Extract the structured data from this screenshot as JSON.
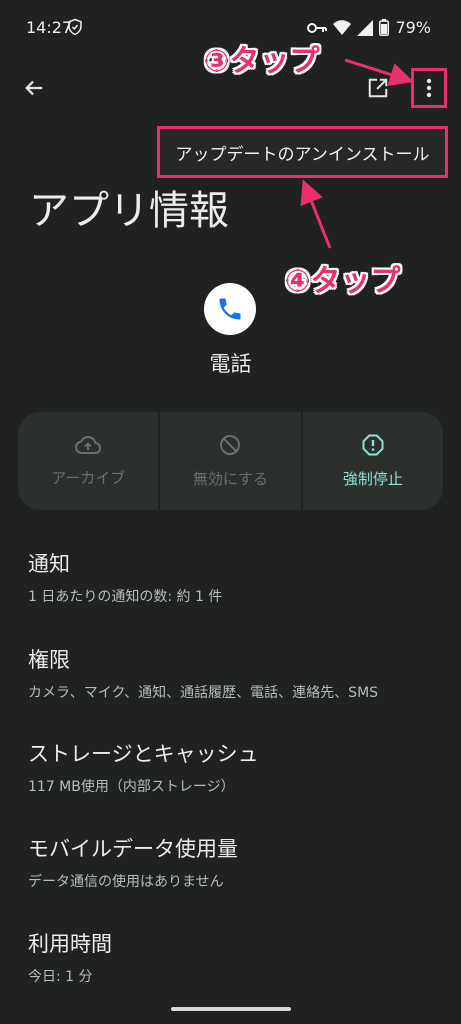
{
  "status_bar": {
    "time": "14:27",
    "battery": "79%"
  },
  "top_bar": {
    "back_icon": "arrow-left-icon",
    "open_icon": "open-in-new-icon",
    "menu_icon": "more-vert-icon"
  },
  "popup_menu": {
    "item": "アップデートのアンインストール"
  },
  "annotations": {
    "step3": "③タップ",
    "step4": "④タップ",
    "color": "#e8316a"
  },
  "page": {
    "title": "アプリ情報",
    "app_name": "電話",
    "app_icon": "phone-icon"
  },
  "actions": [
    {
      "label": "アーカイブ",
      "icon": "cloud-upload-icon",
      "enabled": false
    },
    {
      "label": "無効にする",
      "icon": "block-icon",
      "enabled": false
    },
    {
      "label": "強制停止",
      "icon": "alert-octagon-icon",
      "enabled": true
    }
  ],
  "settings": [
    {
      "title": "通知",
      "subtitle": "1 日あたりの通知の数: 約 1 件"
    },
    {
      "title": "権限",
      "subtitle": "カメラ、マイク、通知、通話履歴、電話、連絡先、SMS"
    },
    {
      "title": "ストレージとキャッシュ",
      "subtitle": "117 MB使用（内部ストレージ）"
    },
    {
      "title": "モバイルデータ使用量",
      "subtitle": "データ通信の使用はありません"
    },
    {
      "title": "利用時間",
      "subtitle": "今日: 1 分"
    }
  ],
  "colors": {
    "background": "#1f2220",
    "accent": "#8fe0d8",
    "highlight": "#e8316a"
  }
}
